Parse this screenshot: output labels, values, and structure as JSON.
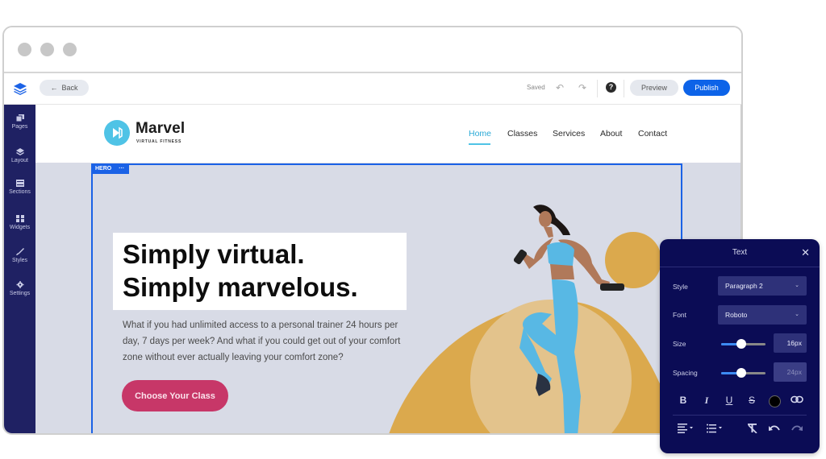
{
  "window": {
    "traffic_lights": [
      "close",
      "minimize",
      "maximize"
    ]
  },
  "toolbar": {
    "logo_icon": "layers-icon",
    "back_label": "Back",
    "status": "Saved",
    "undo_icon": "undo-icon",
    "redo_icon": "redo-icon",
    "help_icon": "help-icon",
    "preview_label": "Preview",
    "publish_label": "Publish"
  },
  "sidebar": {
    "items": [
      {
        "label": "Pages",
        "icon": "pages-icon"
      },
      {
        "label": "Layout",
        "icon": "layers-icon"
      },
      {
        "label": "Sections",
        "icon": "sections-icon"
      },
      {
        "label": "Widgets",
        "icon": "widgets-icon"
      },
      {
        "label": "Styles",
        "icon": "brush-icon"
      },
      {
        "label": "Settings",
        "icon": "gear-icon"
      }
    ]
  },
  "site": {
    "brand": {
      "name": "Marvel",
      "tagline": "VIRTUAL FITNESS"
    },
    "nav": [
      {
        "label": "Home",
        "active": true
      },
      {
        "label": "Classes",
        "active": false
      },
      {
        "label": "Services",
        "active": false
      },
      {
        "label": "About",
        "active": false
      },
      {
        "label": "Contact",
        "active": false
      }
    ],
    "hero": {
      "tag": "HERO",
      "tag_menu": "···",
      "headline_line1": "Simply virtual.",
      "headline_line2": "Simply marvelous.",
      "body": "What if you had unlimited access to a personal trainer 24 hours per day, 7 days per week? And what if you could get out of your comfort zone without ever actually leaving your comfort zone?",
      "cta_label": "Choose Your Class",
      "image_alt": "woman exercising with dumbbells"
    }
  },
  "text_panel": {
    "title": "Text",
    "close_icon": "close-icon",
    "style_label": "Style",
    "style_value": "Paragraph 2",
    "font_label": "Font",
    "font_value": "Roboto",
    "size_label": "Size",
    "size_value": "16px",
    "size_slider_fraction": 0.45,
    "spacing_label": "Spacing",
    "spacing_value": "24px",
    "spacing_slider_fraction": 0.45,
    "format_buttons": [
      "B",
      "I",
      "U",
      "S"
    ],
    "text_color": "#000000"
  },
  "colors": {
    "accent": "#0d63e8",
    "sidebar": "#1f2163",
    "panel": "#0b0c55",
    "cta": "#c73768",
    "brand": "#4fc3e6",
    "gold": "#dba94d"
  }
}
